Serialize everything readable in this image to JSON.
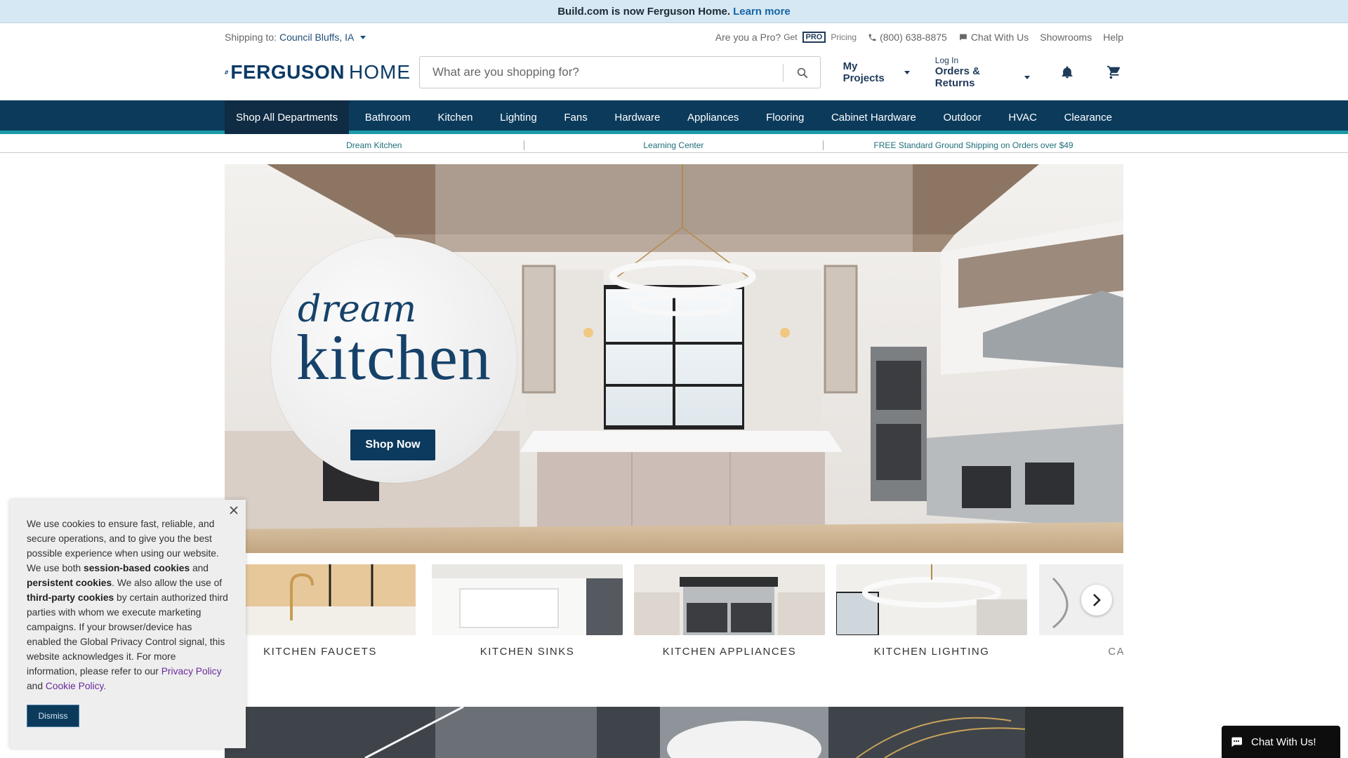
{
  "announcement": {
    "text": "Build.com is now Ferguson Home.",
    "link": "Learn more"
  },
  "utility": {
    "shipping_label": "Shipping to:",
    "shipping_location": "Council Bluffs, IA",
    "pro_question": "Are you a Pro?",
    "pro_get": "Get",
    "pro_badge": "PRO",
    "pro_pricing": "Pricing",
    "phone": "(800) 638-8875",
    "chat": "Chat With Us",
    "showrooms": "Showrooms",
    "help": "Help"
  },
  "header": {
    "logo_brand": "FERGUSON",
    "logo_home": "HOME",
    "search_placeholder": "What are you shopping for?",
    "my_projects": "My Projects",
    "login": "Log In",
    "orders_returns": "Orders & Returns"
  },
  "nav": {
    "items": [
      "Shop All Departments",
      "Bathroom",
      "Kitchen",
      "Lighting",
      "Fans",
      "Hardware",
      "Appliances",
      "Flooring",
      "Cabinet Hardware",
      "Outdoor",
      "HVAC",
      "Clearance"
    ]
  },
  "subnav": {
    "items": [
      "Dream Kitchen",
      "Learning Center",
      "FREE Standard Ground Shipping on Orders over $49"
    ]
  },
  "hero": {
    "title_line1": "dream",
    "title_line2": "kitchen",
    "cta": "Shop Now"
  },
  "categories": [
    {
      "label": "KITCHEN FAUCETS"
    },
    {
      "label": "KITCHEN SINKS"
    },
    {
      "label": "KITCHEN APPLIANCES"
    },
    {
      "label": "KITCHEN LIGHTING"
    },
    {
      "label": "CABINET"
    }
  ],
  "cookie": {
    "p1": "We use cookies to ensure fast, reliable, and secure operations, and to give you the best possible experience when using our website. We use both ",
    "b1": "session-based cookies",
    "p2": " and ",
    "b2": "persistent cookies",
    "p3": ". We also allow the use of ",
    "b3": "third-party cookies",
    "p4": " by certain authorized third parties with whom we execute marketing campaigns. If your browser/device has enabled the Global Privacy Control signal, this website acknowledges it. For more information, please refer to our ",
    "privacy_link": "Privacy Policy",
    "and": " and ",
    "cookie_link": "Cookie Policy.",
    "dismiss": "Dismiss"
  },
  "chat_widget": {
    "label": "Chat With Us!"
  },
  "colors": {
    "nav_bg": "#0b3a5b",
    "accent_teal": "#1a9aa6",
    "brand_blue": "#0b3a66"
  }
}
